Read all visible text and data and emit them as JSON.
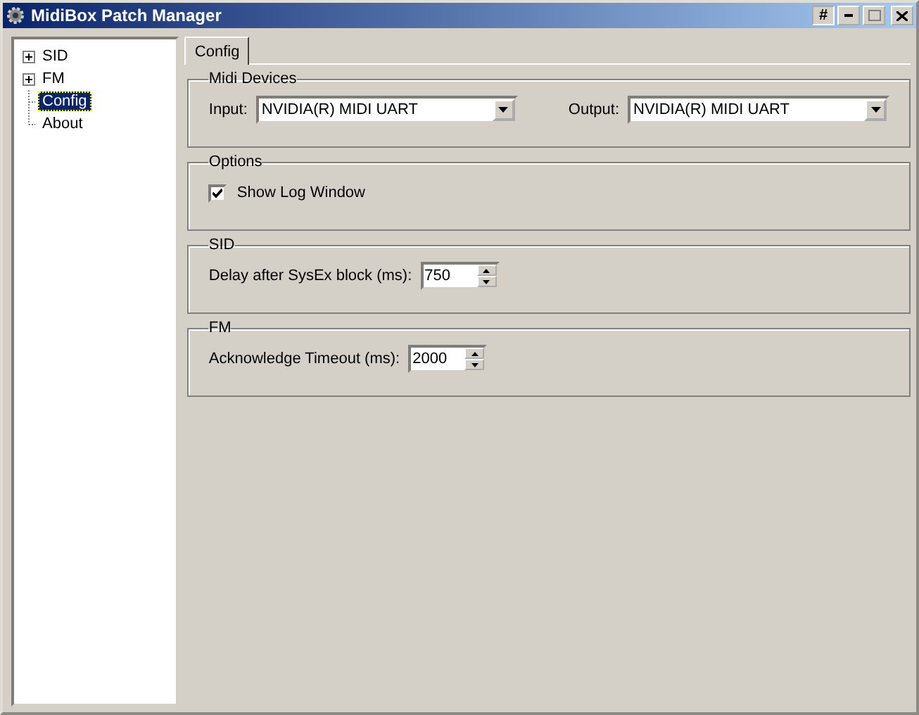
{
  "window": {
    "title": "MidiBox Patch Manager",
    "buttons": [
      "#"
    ]
  },
  "tree": [
    {
      "kind": "branch",
      "label": "SID",
      "expanded": false,
      "selected": false
    },
    {
      "kind": "branch",
      "label": "FM",
      "expanded": false,
      "selected": false
    },
    {
      "kind": "leaf",
      "label": "Config",
      "selected": true
    },
    {
      "kind": "leaf",
      "label": "About",
      "selected": false
    }
  ],
  "tabs": [
    {
      "label": "Config",
      "selected": true
    }
  ],
  "groups": [
    {
      "title": "Midi Devices",
      "rows": [
        {
          "kind": "dropdowns",
          "fields": [
            {
              "label": "Input:",
              "value": "NVIDIA(R) MIDI UART"
            },
            {
              "label": "Output:",
              "value": "NVIDIA(R) MIDI UART"
            }
          ]
        }
      ]
    },
    {
      "title": "Options",
      "rows": [
        {
          "kind": "checkbox",
          "label": "Show Log Window",
          "checked": true
        }
      ]
    },
    {
      "title": "SID",
      "rows": [
        {
          "kind": "spin",
          "label": "Delay after SysEx block (ms):",
          "value": "750"
        }
      ]
    },
    {
      "title": "FM",
      "rows": [
        {
          "kind": "spin",
          "label": "Acknowledge Timeout (ms):",
          "value": "2000"
        }
      ]
    }
  ]
}
